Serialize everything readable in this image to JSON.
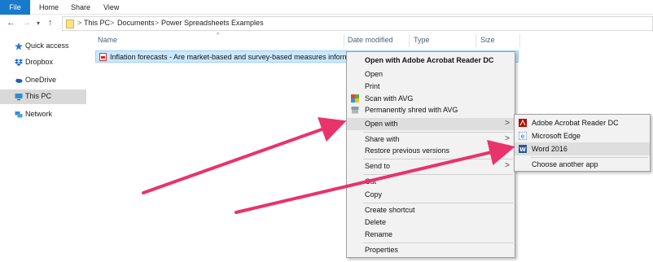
{
  "ribbon": {
    "tabs": [
      "File",
      "Home",
      "Share",
      "View"
    ]
  },
  "address": {
    "crumbs": [
      "This PC",
      "Documents",
      "Power Spreadsheets Examples"
    ],
    "separator": ">"
  },
  "sidebar": {
    "items": [
      {
        "label": "Quick access",
        "icon": "star-icon",
        "color": "#2a77d0"
      },
      {
        "label": "Dropbox",
        "icon": "dropbox-icon",
        "color": "#0062d6"
      },
      {
        "label": "OneDrive",
        "icon": "cloud-icon",
        "color": "#1a5fb4"
      },
      {
        "label": "This PC",
        "icon": "computer-icon",
        "color": "#2d8fd5"
      },
      {
        "label": "Network",
        "icon": "network-icon",
        "color": "#2d8fd5"
      }
    ]
  },
  "columns": {
    "name": "Name",
    "date": "Date modified",
    "type": "Type",
    "size": "Size"
  },
  "file": {
    "name": "Inflation forecasts - Are market-based and survey-based measures informative"
  },
  "context_menu": {
    "items": [
      {
        "label": "Open with Adobe Acrobat Reader DC"
      },
      {
        "label": "Open"
      },
      {
        "label": "Print"
      },
      {
        "label": "Scan with AVG"
      },
      {
        "label": "Permanently shred with AVG"
      },
      {
        "label": "Open with"
      },
      {
        "label": "Share with"
      },
      {
        "label": "Restore previous versions"
      },
      {
        "label": "Send to"
      },
      {
        "label": "Cut"
      },
      {
        "label": "Copy"
      },
      {
        "label": "Create shortcut"
      },
      {
        "label": "Delete"
      },
      {
        "label": "Rename"
      },
      {
        "label": "Properties"
      }
    ],
    "submenu_arrow": ">"
  },
  "submenu": {
    "items": [
      {
        "label": "Adobe Acrobat Reader DC"
      },
      {
        "label": "Microsoft Edge"
      },
      {
        "label": "Word 2016"
      },
      {
        "label": "Choose another app"
      }
    ]
  },
  "colors": {
    "accent": "#1979ca",
    "selection": "#cce8ff",
    "arrow": "#e8336b"
  }
}
